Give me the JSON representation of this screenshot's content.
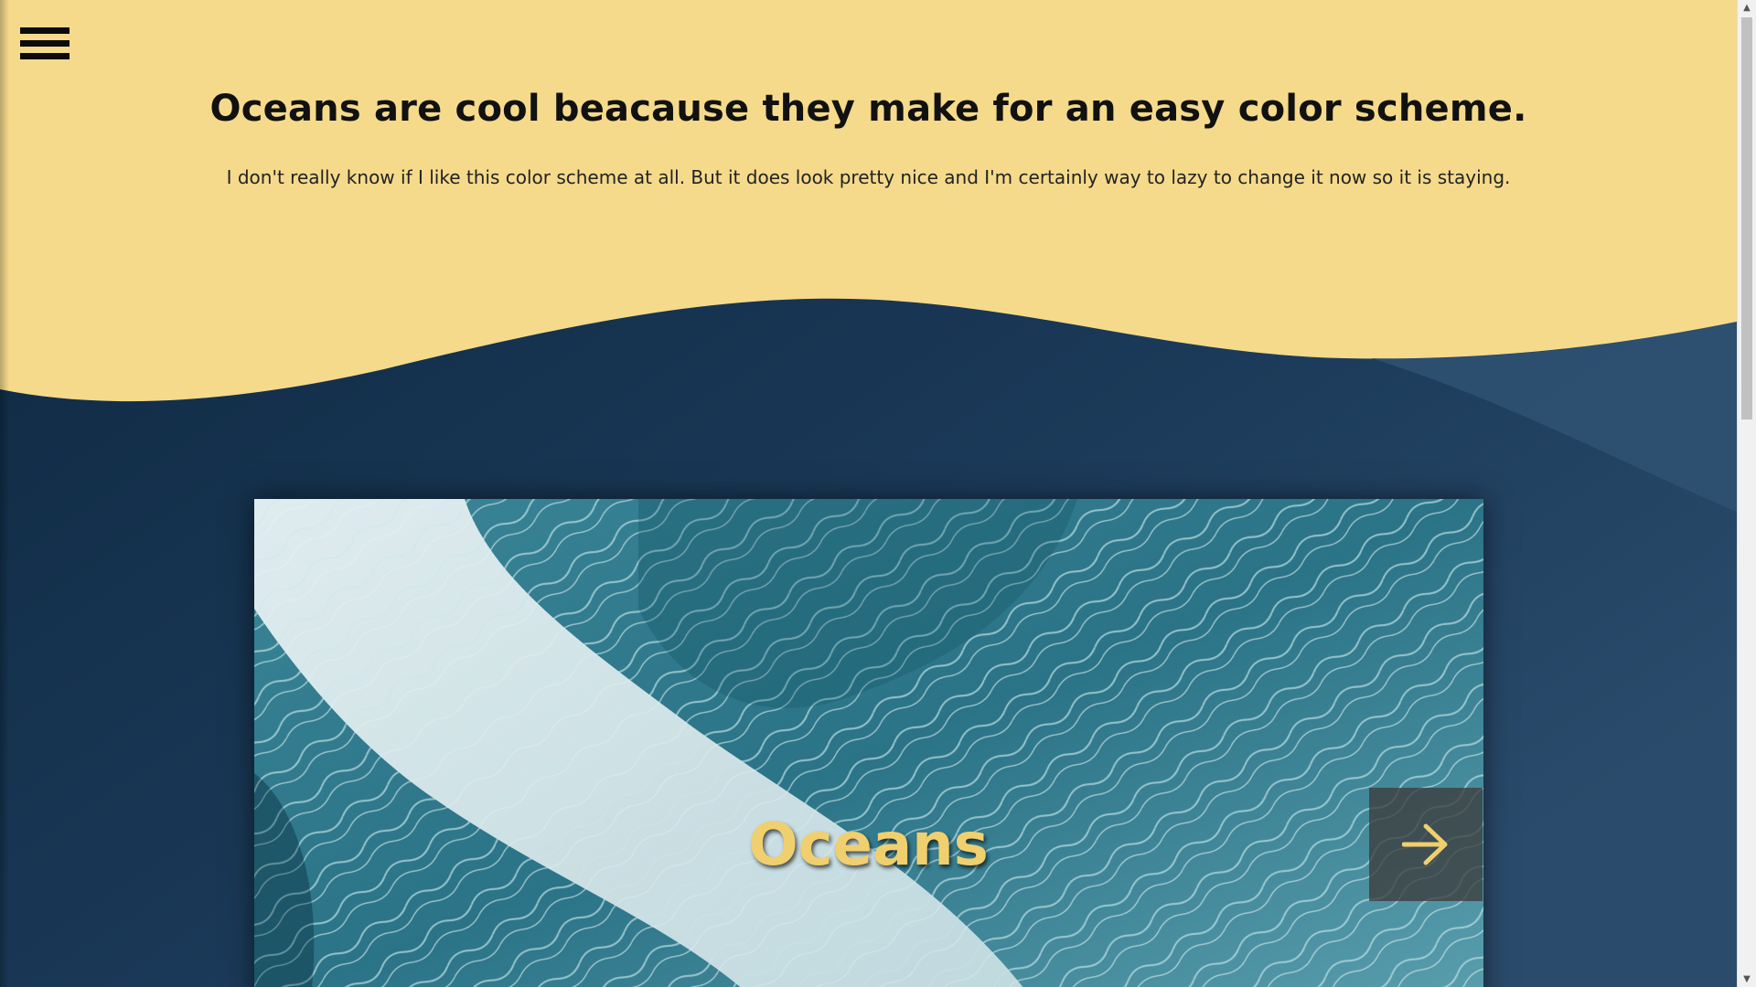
{
  "nav": {
    "menu_icon": "hamburger-menu-icon"
  },
  "hero": {
    "title": "Oceans are cool beacause they make for an easy color scheme.",
    "subtitle": "I don't really know if I like this color scheme at all. But it does look pretty nice and I'm certainly way to lazy to change it now so it is staying."
  },
  "slider": {
    "slide_title": "Oceans",
    "next_icon": "arrow-right-icon"
  },
  "colors": {
    "sand": "#f5da8b",
    "navy": "#17344f",
    "navy_light": "#2d5070",
    "accent_gold": "#f0cf6f"
  }
}
